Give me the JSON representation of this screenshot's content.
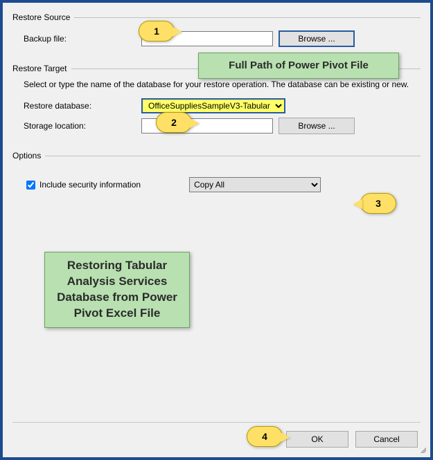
{
  "restore_source": {
    "legend": "Restore Source",
    "backup_label": "Backup file:",
    "backup_value": "",
    "browse_label": "Browse ..."
  },
  "restore_target": {
    "legend": "Restore Target",
    "help": "Select or type the name of the database for your restore operation. The database can be existing or new.",
    "db_label": "Restore database:",
    "db_value": "OfficeSuppliesSampleV3-Tabular",
    "storage_label": "Storage location:",
    "storage_value": "",
    "browse_label": "Browse ..."
  },
  "options": {
    "legend": "Options",
    "include_security_label": "Include security information",
    "include_security_checked": true,
    "security_mode": "Copy All"
  },
  "buttons": {
    "ok": "OK",
    "cancel": "Cancel"
  },
  "callouts": {
    "c1": "1",
    "c2": "2",
    "c3": "3",
    "c4": "4"
  },
  "annotations": {
    "a1": "Full Path of Power Pivot File",
    "a2": "Restoring Tabular Analysis Services Database from Power Pivot Excel File"
  }
}
